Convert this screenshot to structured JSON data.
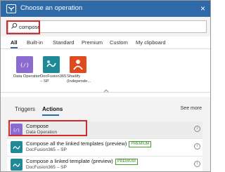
{
  "header": {
    "title": "Choose an operation",
    "close_label": "×"
  },
  "search": {
    "value": "compose",
    "placeholder": ""
  },
  "filters": [
    {
      "label": "All"
    },
    {
      "label": "Built-in"
    },
    {
      "label": "Standard"
    },
    {
      "label": "Premium"
    },
    {
      "label": "Custom"
    },
    {
      "label": "My clipboard"
    }
  ],
  "connectors": [
    {
      "label": "Data Operation",
      "icon": "data-operation-icon",
      "color": "#8c6bd0"
    },
    {
      "label": "DocFusion365 – SP",
      "icon": "docfusion-icon",
      "color": "#1f8a96"
    },
    {
      "label": "Shadify (Independe...",
      "icon": "shadify-icon",
      "color": "#e04b1d"
    }
  ],
  "collapse_icon": "chevron-up-icon",
  "subtabs": [
    {
      "label": "Triggers"
    },
    {
      "label": "Actions"
    }
  ],
  "see_more": "See more",
  "actions": [
    {
      "title": "Compose",
      "subtitle": "Data Operation",
      "badge": "",
      "color": "#8c6bd0"
    },
    {
      "title": "Compose all the linked templates (preview)",
      "subtitle": "DocFusion365 – SP",
      "badge": "PREMIUM",
      "color": "#1f8a96"
    },
    {
      "title": "Compose a linked template (preview)",
      "subtitle": "DocFusion365 – SP",
      "badge": "PREMIUM",
      "color": "#1f8a96"
    }
  ],
  "colors": {
    "header": "#2f6aa8",
    "highlight": "#d22b2b",
    "premium": "#3d8a2b"
  }
}
